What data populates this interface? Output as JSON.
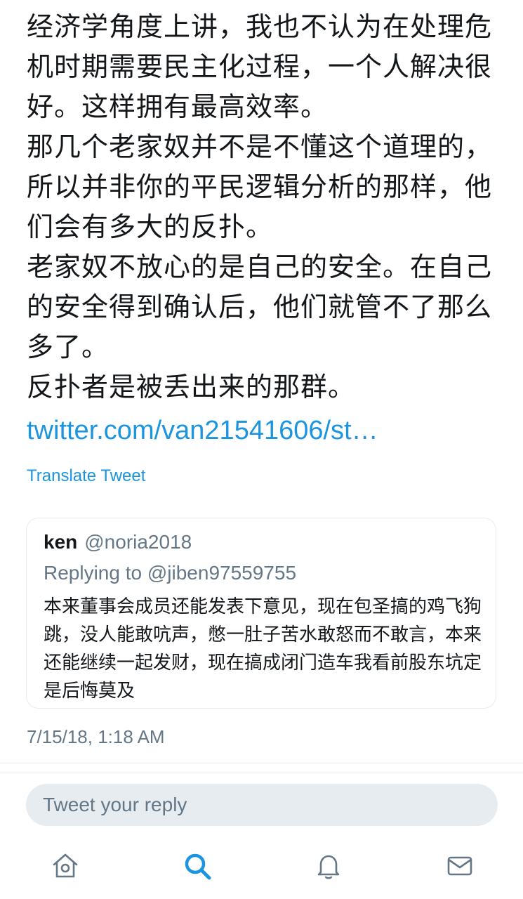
{
  "tweet": {
    "paragraphs": [
      "经济学角度上讲，我也不认为在处理危机时期需要民主化过程，一个人解决很好。这样拥有最高效率。",
      "那几个老家奴并不是不懂这个道理的，所以并非你的平民逻辑分析的那样，他们会有多大的反扑。",
      "老家奴不放心的是自己的安全。在自己的安全得到确认后，他们就管不了那么多了。",
      "反扑者是被丢出来的那群。"
    ],
    "link": "twitter.com/van21541606/st…",
    "translate_label": "Translate Tweet",
    "timestamp": "7/15/18, 1:18 AM"
  },
  "quote": {
    "name": "ken",
    "handle": "@noria2018",
    "replying_to": "Replying to @jiben97559755",
    "text": "本来董事会成员还能发表下意见，现在包圣搞的鸡飞狗跳，没人能敢吭声，憋一肚子苦水敢怒而不敢言，本来还能继续一起发财，现在搞成闭门造车我看前股东坑定是后悔莫及"
  },
  "reply": {
    "placeholder": "Tweet your reply"
  },
  "tabs": [
    {
      "icon": "home-icon",
      "active": false
    },
    {
      "icon": "search-icon",
      "active": true
    },
    {
      "icon": "bell-icon",
      "active": false
    },
    {
      "icon": "mail-icon",
      "active": false
    }
  ],
  "colors": {
    "accent": "#1b95e0",
    "secondary_text": "#657786",
    "border": "#e6ecf0"
  }
}
